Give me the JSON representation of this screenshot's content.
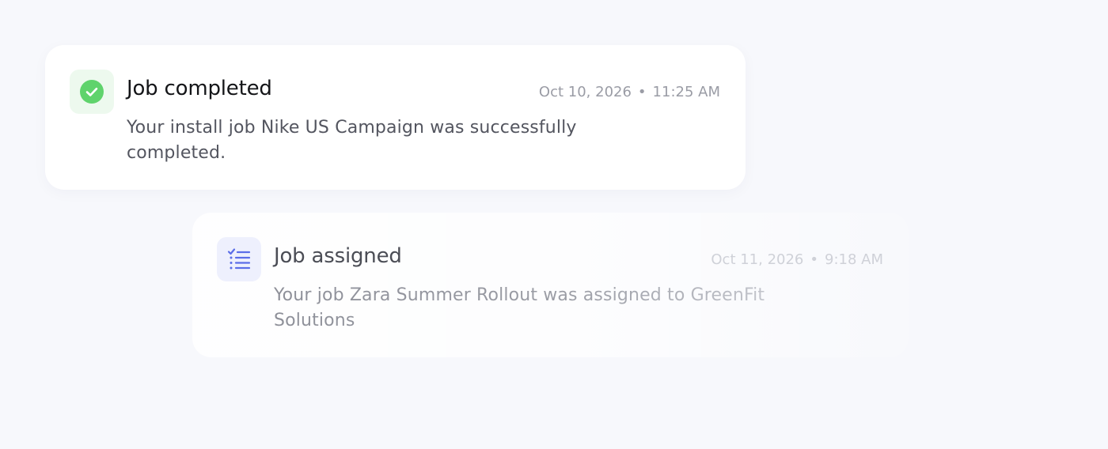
{
  "notifications": [
    {
      "title": "Job completed",
      "date": "Oct 10, 2026",
      "separator": "•",
      "time": "11:25 AM",
      "message": "Your install job Nike US Campaign was successfully completed.",
      "icon": "check-circle-icon",
      "accent_color": "#5fd36c"
    },
    {
      "title": "Job assigned",
      "date": "Oct 11, 2026",
      "separator": "•",
      "time": "9:18 AM",
      "message": "Your job Zara Summer Rollout was assigned to GreenFit Solutions",
      "icon": "checklist-icon",
      "accent_color": "#5b6ee8"
    }
  ]
}
